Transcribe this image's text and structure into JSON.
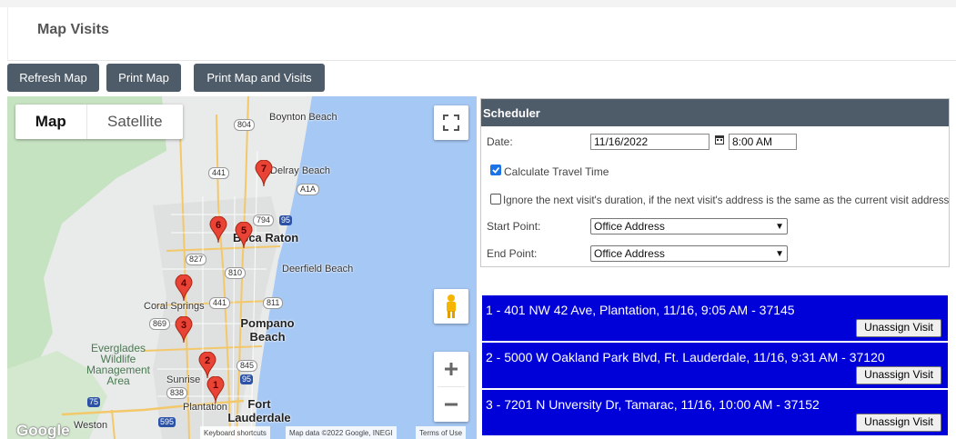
{
  "header": {
    "title": "Map Visits"
  },
  "toolbar": {
    "refresh_label": "Refresh Map",
    "print_label": "Print Map",
    "print_visits_label": "Print Map and Visits"
  },
  "map": {
    "type_map": "Map",
    "type_satellite": "Satellite",
    "labels": {
      "boynton": "Boynton Beach",
      "delray": "Delray Beach",
      "boca": "Boca Raton",
      "deerfield": "Deerfield Beach",
      "coral": "Coral Springs",
      "pompano": "Pompano Beach",
      "everglades": "Everglades Wildlife Management Area",
      "sunrise": "Sunrise",
      "plantation": "Plantation",
      "fort": "Fort Lauderdale",
      "weston": "Weston"
    },
    "shields": {
      "s804": "804",
      "s441a": "441",
      "sA1A": "A1A",
      "s794": "794",
      "s95a": "95",
      "s827": "827",
      "s810": "810",
      "s441b": "441",
      "s811": "811",
      "s869": "869",
      "s845": "845",
      "s838": "838",
      "s95b": "95",
      "s75": "75",
      "s595": "595"
    },
    "pins": [
      "1",
      "2",
      "3",
      "4",
      "5",
      "6",
      "7"
    ],
    "google": "Google",
    "attr_shortcuts": "Keyboard shortcuts",
    "attr_data": "Map data ©2022 Google, INEGI",
    "attr_terms": "Terms of Use",
    "colors": {
      "water": "#a6c8f4",
      "land": "#e9eaea",
      "park": "#c6e3c1",
      "pin": "#e94335"
    }
  },
  "scheduler": {
    "title": "Scheduler",
    "date_label": "Date:",
    "date_value": "11/16/2022",
    "time_value": "8:00 AM",
    "calc_travel_label": "Calculate Travel Time",
    "calc_travel_checked": true,
    "ignore_label": "Ignore the next visit's duration, if the next visit's address is the same as the current visit address",
    "ignore_checked": false,
    "start_label": "Start Point:",
    "start_value": "Office Address",
    "end_label": "End Point:",
    "end_value": "Office Address"
  },
  "visits": [
    {
      "text": "1 - 401 NW 42 Ave, Plantation, 11/16, 9:05 AM - 37145",
      "button": "Unassign Visit"
    },
    {
      "text": "2 - 5000 W Oakland Park Blvd, Ft. Lauderdale, 11/16, 9:31 AM - 37120",
      "button": "Unassign Visit"
    },
    {
      "text": "3 - 7201 N Unversity Dr, Tamarac, 11/16, 10:00 AM - 37152",
      "button": "Unassign Visit"
    }
  ]
}
